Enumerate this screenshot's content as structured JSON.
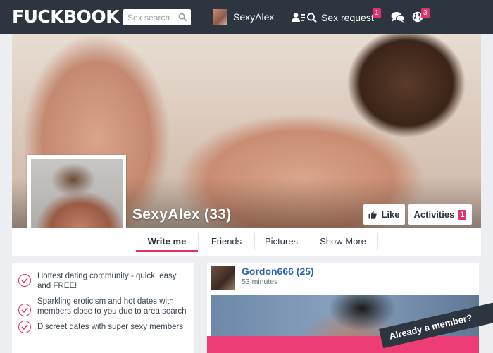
{
  "header": {
    "logo": "FUCKBOOK",
    "search_placeholder": "Sex search",
    "username": "SexyAlex",
    "sex_request_label": "Sex request",
    "sex_request_count": "1",
    "globe_count": "3"
  },
  "profile": {
    "name": "SexyAlex (33)",
    "like_label": "Like",
    "activities_label": "Activities",
    "activities_count": "1"
  },
  "tabs": [
    {
      "label": "Write me",
      "active": true
    },
    {
      "label": "Friends",
      "active": false
    },
    {
      "label": "Pictures",
      "active": false
    },
    {
      "label": "Show More",
      "active": false
    }
  ],
  "features": [
    "Hottest dating community - quick, easy and FREE!",
    "Sparkling eroticism and hot dates with members close to you due to area search",
    "Discreet dates with super sexy members"
  ],
  "feed": {
    "name": "Gordon666 (25)",
    "time": "53 minutes"
  },
  "ribbon": "Already a member?",
  "colors": {
    "topbar": "#2d3540",
    "accent": "#e0336b",
    "link": "#2c63b0"
  }
}
